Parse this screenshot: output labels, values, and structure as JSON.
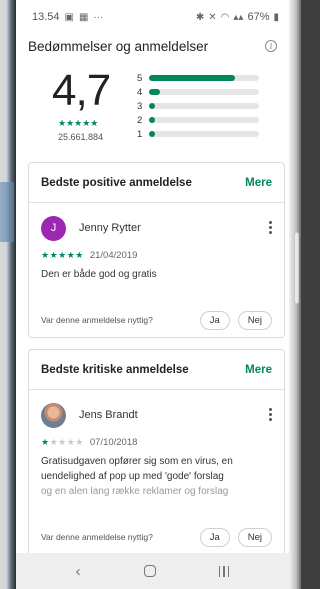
{
  "status_bar": {
    "time": "13.54",
    "left_icons": [
      "image-icon",
      "calendar-icon",
      "more-icon"
    ],
    "overflow": "···",
    "right_icons": [
      "bluetooth-icon",
      "mute-icon",
      "wifi-icon",
      "signal-icon"
    ],
    "battery": "67%"
  },
  "header": {
    "title": "Bedømmelser og anmeldelser",
    "info_icon": "info-icon"
  },
  "summary": {
    "rating": "4,7",
    "stars": "★★★★★",
    "review_count": "25.661.884"
  },
  "histogram": {
    "rows": [
      {
        "label": "5",
        "fraction": 0.78
      },
      {
        "label": "4",
        "fraction": 0.1
      },
      {
        "label": "3",
        "fraction": 0.03
      },
      {
        "label": "2",
        "fraction": 0.02
      },
      {
        "label": "1",
        "fraction": 0.04
      }
    ],
    "accent": "#01875f"
  },
  "positive": {
    "card_title": "Bedste positive anmeldelse",
    "more": "Mere",
    "avatar_letter": "J",
    "avatar_color": "#9c27b0",
    "name": "Jenny Rytter",
    "rating": 5,
    "stars": "★★★★★",
    "date": "21/04/2019",
    "text": "Den er både god og gratis",
    "helpful_question": "Var denne anmeldelse nyttig?",
    "yes": "Ja",
    "no": "Nej"
  },
  "critical": {
    "card_title": "Bedste kritiske anmeldelse",
    "more": "Mere",
    "name": "Jens Brandt",
    "rating": 1,
    "stars_filled": "★",
    "stars_empty": "★★★★",
    "date": "07/10/2018",
    "text_line1": "Gratisudgaven opfører sig som en virus, en",
    "text_line2": "uendelighed af pop up med 'gode' forslag",
    "text_line3": "og en alen lang række reklamer og forslag",
    "helpful_question": "Var denne anmeldelse nyttig?",
    "yes": "Ja",
    "no": "Nej"
  },
  "nav_bar": {
    "back": "‹",
    "home_icon": "home-icon",
    "recents_icon": "recents-icon"
  }
}
